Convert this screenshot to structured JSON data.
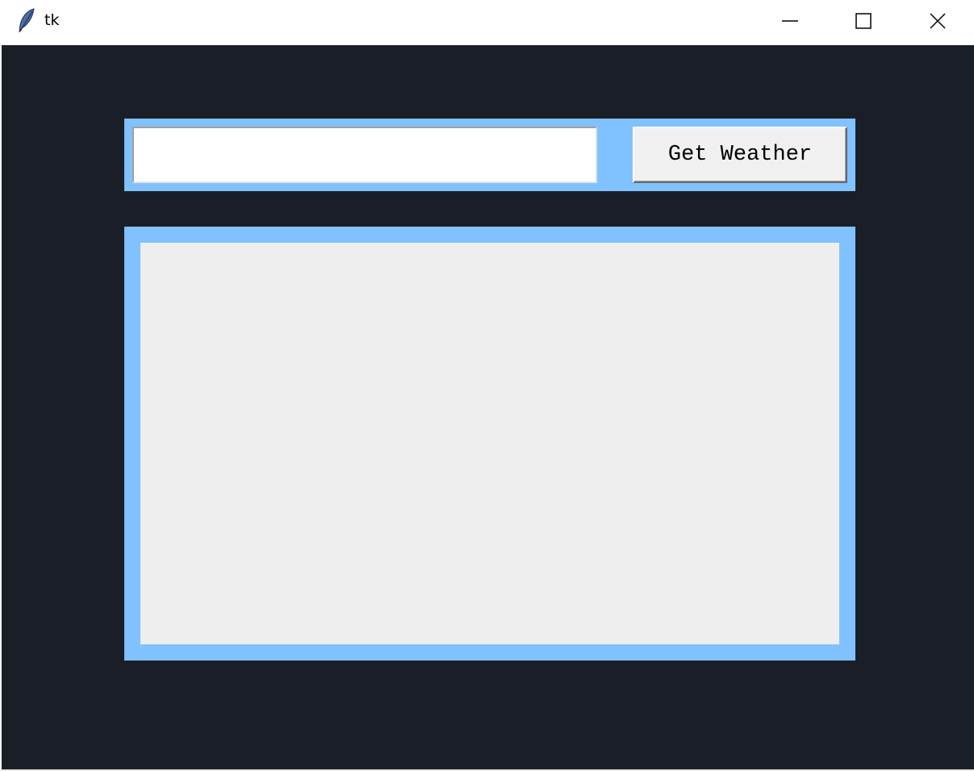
{
  "window": {
    "title": "tk",
    "app_icon": "feather-icon",
    "controls": [
      "minimize-icon",
      "maximize-icon",
      "close-icon"
    ]
  },
  "form": {
    "city_input_value": "",
    "button_label": "Get Weather"
  },
  "result": {
    "text": ""
  },
  "colors": {
    "background": "#1a1f27",
    "frame": "#80c1ff",
    "label_bg": "#eeeeee",
    "button_bg": "#f0f0f0"
  }
}
